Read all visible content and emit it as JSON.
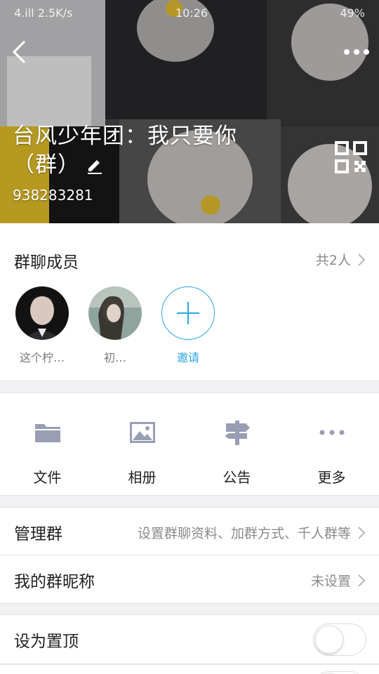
{
  "status_bar": {
    "left": "4.ill 2.5K/s",
    "time": "10:26",
    "battery": "49%"
  },
  "header": {
    "group_name": "台风少年团：我只要你（群）",
    "group_number": "938283281",
    "icons": [
      "back-icon",
      "more-icon",
      "edit-icon",
      "qr-code-icon"
    ]
  },
  "members": {
    "title": "群聊成员",
    "count_label": "共2人",
    "list": [
      {
        "name": "这个柠…"
      },
      {
        "name": "初…"
      }
    ],
    "invite_label": "邀请"
  },
  "actions": [
    {
      "label": "文件",
      "icon": "folder-icon"
    },
    {
      "label": "相册",
      "icon": "photo-icon"
    },
    {
      "label": "公告",
      "icon": "signpost-icon"
    },
    {
      "label": "更多",
      "icon": "more-dots-icon"
    }
  ],
  "settings": {
    "manage": {
      "title": "管理群",
      "value": "设置群聊资料、加群方式、千人群等"
    },
    "nickname": {
      "title": "我的群昵称",
      "value": "未设置"
    },
    "pin_top": {
      "title": "设为置顶",
      "enabled": false
    }
  },
  "colors": {
    "accent": "#29a7e1",
    "icon_gray": "#9a9eb4"
  }
}
